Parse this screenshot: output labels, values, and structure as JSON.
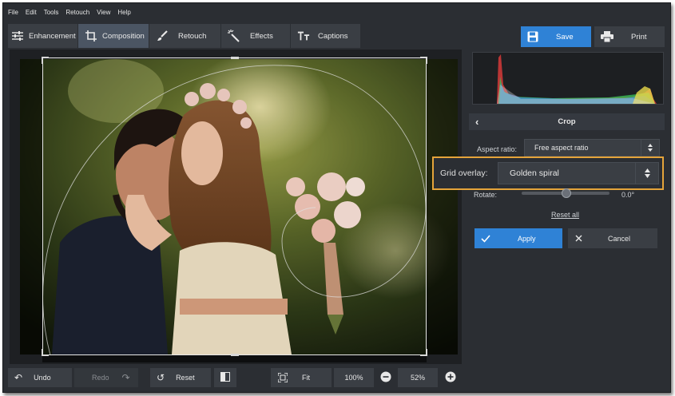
{
  "menu": [
    "File",
    "Edit",
    "Tools",
    "Retouch",
    "View",
    "Help"
  ],
  "tabs": [
    {
      "label": "Enhancement",
      "icon": "sliders-icon"
    },
    {
      "label": "Composition",
      "icon": "crop-icon"
    },
    {
      "label": "Retouch",
      "icon": "brush-icon"
    },
    {
      "label": "Effects",
      "icon": "magic-wand-icon"
    },
    {
      "label": "Captions",
      "icon": "text-icon"
    }
  ],
  "toolbar": {
    "save_label": "Save",
    "print_label": "Print"
  },
  "colors": {
    "accent": "#2f82d6",
    "highlight": "#e5a43a"
  },
  "bottom": {
    "undo": "Undo",
    "redo": "Redo",
    "reset": "Reset",
    "fit": "Fit",
    "zoom_100": "100%",
    "zoom_value": "52%"
  },
  "panel": {
    "title": "Crop",
    "aspect_label": "Aspect ratio:",
    "aspect_value": "Free aspect ratio",
    "grid_label": "Grid overlay:",
    "grid_value": "Golden spiral",
    "rotate_label": "Rotate:",
    "rotate_value": "0.0°",
    "rotate_level": 0.5,
    "reset_all": "Reset all",
    "apply": "Apply",
    "cancel": "Cancel"
  }
}
